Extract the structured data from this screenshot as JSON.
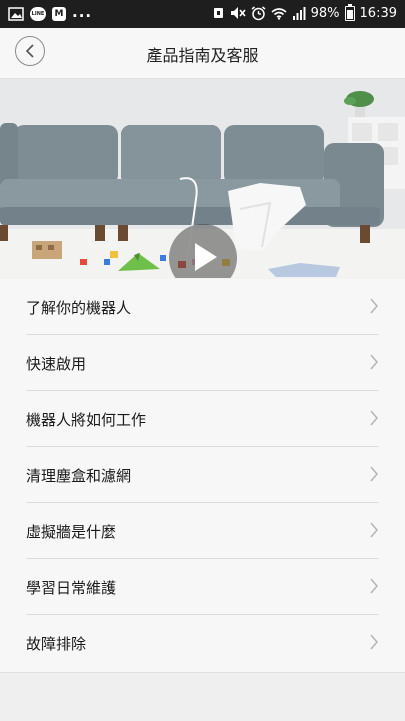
{
  "status_bar": {
    "battery_text": "98%",
    "time": "16:39",
    "left_icons": [
      "image-icon",
      "line-app-icon",
      "mi-app-icon"
    ],
    "right_icons": [
      "alarm-clock-icon",
      "mute-icon",
      "wifi-icon",
      "signal-icon",
      "battery-icon"
    ],
    "more_indicator": "...",
    "line_badge": "LINE",
    "mi_badge": "M"
  },
  "header": {
    "title": "產品指南及客服",
    "back_icon": "chevron-left-icon"
  },
  "hero": {
    "play_icon": "play-icon"
  },
  "menu": {
    "items": [
      {
        "label": "了解你的機器人"
      },
      {
        "label": "快速啟用"
      },
      {
        "label": "機器人將如何工作"
      },
      {
        "label": "清理塵盒和濾網"
      },
      {
        "label": "虛擬牆是什麼"
      },
      {
        "label": "學習日常維護"
      },
      {
        "label": "故障排除"
      }
    ],
    "chevron_icon": "chevron-right-icon"
  },
  "colors": {
    "status_bar_bg": "#1e1e1e",
    "header_bg": "#f7f7f7",
    "list_bg": "#f7f7f7",
    "divider": "#dcdcdc",
    "chevron": "#b4b4b4"
  }
}
